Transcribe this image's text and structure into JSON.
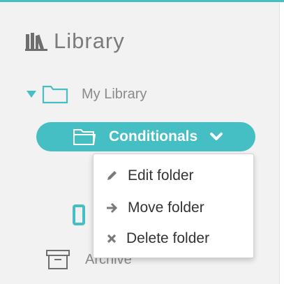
{
  "header": {
    "title": "Library",
    "icon": "library-icon"
  },
  "tree": {
    "root": {
      "label": "My Library",
      "icon": "folder-icon",
      "expanded": true
    },
    "selected": {
      "label": "Conditionals",
      "icon": "folder-open-icon"
    },
    "archive": {
      "label": "Archive",
      "icon": "archive-icon"
    }
  },
  "context_menu": {
    "items": [
      {
        "label": "Edit folder",
        "icon": "pencil-icon"
      },
      {
        "label": "Move folder",
        "icon": "arrow-right-icon"
      },
      {
        "label": "Delete folder",
        "icon": "x-icon"
      }
    ]
  },
  "colors": {
    "accent": "#45bfc3",
    "text_muted": "#8a8a8a",
    "menu_text": "#333333"
  }
}
